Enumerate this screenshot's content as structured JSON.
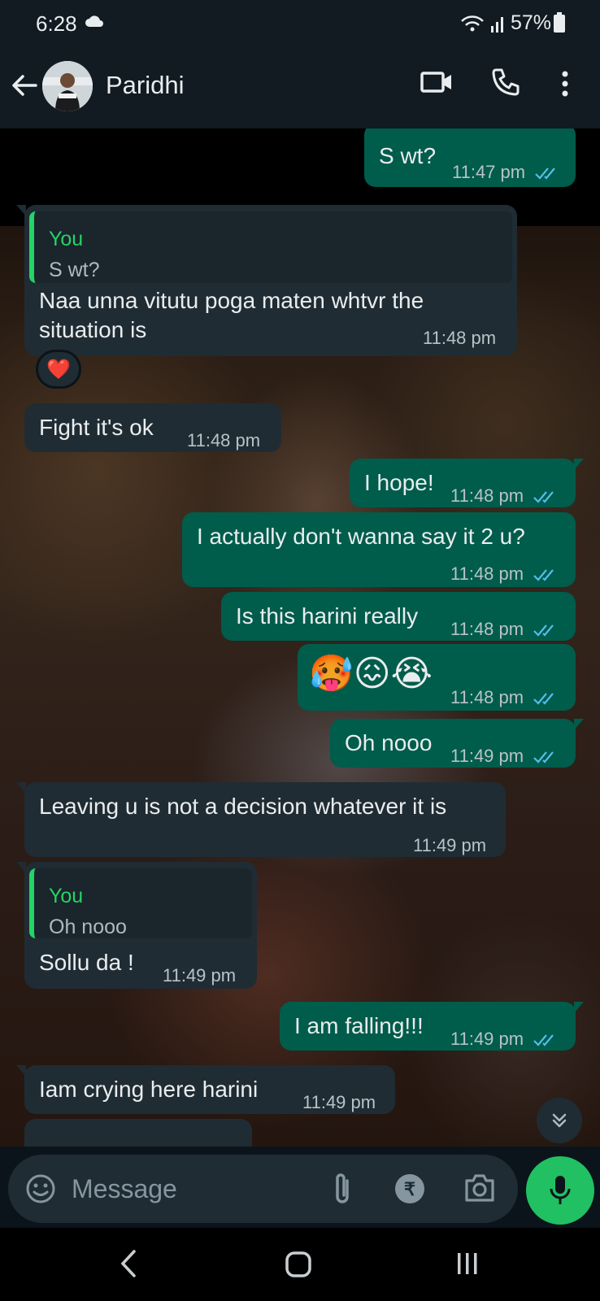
{
  "status_bar": {
    "time": "6:28",
    "battery": "57%"
  },
  "header": {
    "contact_name": "Paridhi"
  },
  "messages": [
    {
      "dir": "out",
      "text": "S wt?",
      "time": "11:47 pm"
    },
    {
      "dir": "in",
      "quote_author": "You",
      "quote_text": "S wt?",
      "text_line1": "Naa unna vitutu poga maten whtvr the",
      "text_line2": "situation is",
      "time": "11:48 pm",
      "reaction": "❤️"
    },
    {
      "dir": "in",
      "text": "Fight it's ok",
      "time": "11:48 pm"
    },
    {
      "dir": "out",
      "text": "I hope!",
      "time": "11:48 pm"
    },
    {
      "dir": "out",
      "text": "I actually don't wanna say it 2 u?",
      "time": "11:48 pm"
    },
    {
      "dir": "out",
      "text": "Is this harini really",
      "time": "11:48 pm"
    },
    {
      "dir": "out",
      "text": "🥵😖😭",
      "time": "11:48 pm"
    },
    {
      "dir": "out",
      "text": "Oh nooo",
      "time": "11:49 pm"
    },
    {
      "dir": "in",
      "text": "Leaving u is not a decision whatever it is",
      "time": "11:49 pm"
    },
    {
      "dir": "in",
      "quote_author": "You",
      "quote_text": "Oh nooo",
      "text": "Sollu da !",
      "time": "11:49 pm"
    },
    {
      "dir": "out",
      "text": "I am falling!!!",
      "time": "11:49 pm"
    },
    {
      "dir": "in",
      "text": "Iam crying here harini",
      "time": "11:49 pm"
    }
  ],
  "input": {
    "placeholder": "Message"
  },
  "colors": {
    "outgoing": "#005c4b",
    "incoming": "#202c33",
    "accent": "#25d366",
    "read_ticks": "#53bdeb"
  },
  "icons": [
    "cloud-icon",
    "wifi-icon",
    "signal-icon",
    "battery-icon",
    "back-arrow-icon",
    "video-call-icon",
    "phone-icon",
    "more-options-icon",
    "emoji-icon",
    "attach-icon",
    "rupee-icon",
    "camera-icon",
    "mic-icon",
    "scroll-down-icon"
  ]
}
